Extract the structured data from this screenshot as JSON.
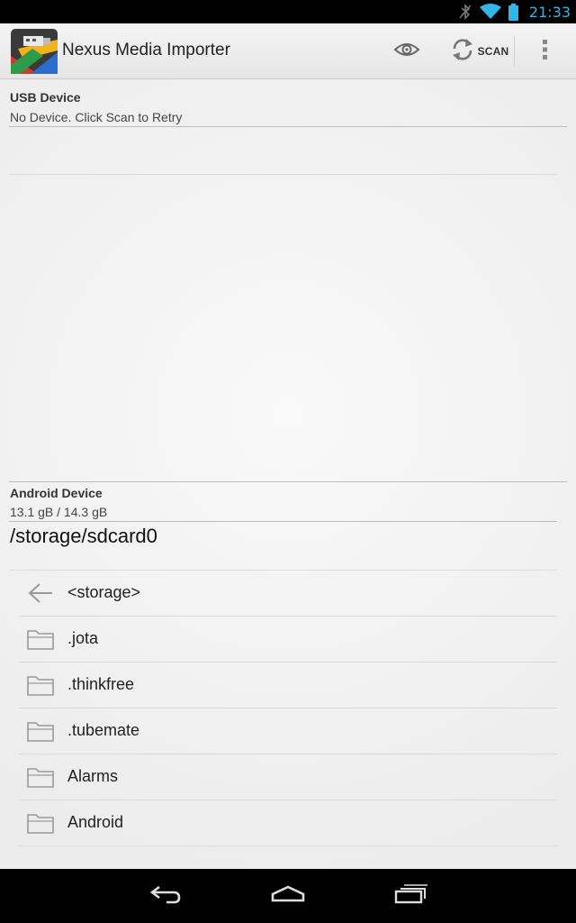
{
  "status_bar": {
    "time": "21:33",
    "icons": [
      "bluetooth-off-icon",
      "wifi-icon",
      "battery-icon"
    ],
    "accent_color": "#33b5e5"
  },
  "action_bar": {
    "app_title": "Nexus Media Importer",
    "app_icon": "usb-import-app-icon",
    "actions": {
      "view_icon": "eye-icon",
      "scan_icon": "refresh-icon",
      "scan_label": "SCAN",
      "overflow_icon": "overflow-menu-icon"
    }
  },
  "usb_section": {
    "title": "USB Device",
    "status": "No Device. Click Scan to Retry"
  },
  "android_section": {
    "title": "Android Device",
    "storage": "13.1 gB / 14.3 gB",
    "current_path": "/storage/sdcard0"
  },
  "file_list": [
    {
      "name": "<storage>",
      "icon": "back-arrow-icon"
    },
    {
      "name": ".jota",
      "icon": "folder-icon"
    },
    {
      "name": ".thinkfree",
      "icon": "folder-icon"
    },
    {
      "name": ".tubemate",
      "icon": "folder-icon"
    },
    {
      "name": "Alarms",
      "icon": "folder-icon"
    },
    {
      "name": "Android",
      "icon": "folder-icon"
    }
  ],
  "nav_bar": {
    "buttons": [
      "back-icon",
      "home-icon",
      "recents-icon"
    ]
  }
}
